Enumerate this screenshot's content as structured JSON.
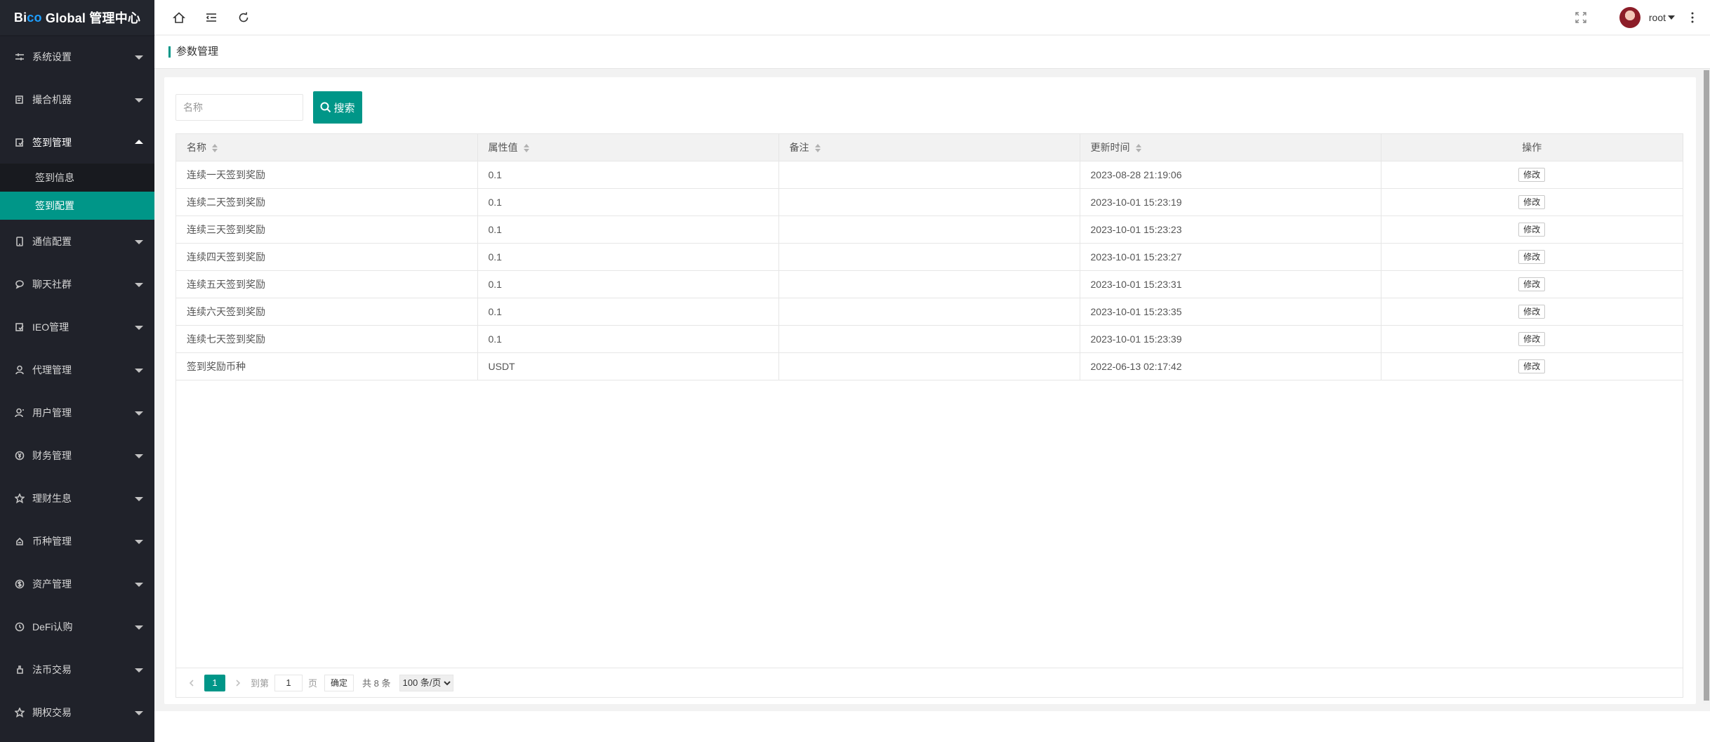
{
  "logo": {
    "part1": "Bi",
    "part2": "co",
    "part3": " Global 管理中心"
  },
  "sidebar": {
    "items": [
      {
        "label": "系统设置",
        "icon": "sliders-icon"
      },
      {
        "label": "撮合机器",
        "icon": "robot-icon"
      },
      {
        "label": "签到管理",
        "icon": "checkin-icon",
        "open": true
      },
      {
        "label": "通信配置",
        "icon": "phone-icon"
      },
      {
        "label": "聊天社群",
        "icon": "chat-icon"
      },
      {
        "label": "IEO管理",
        "icon": "ieo-icon"
      },
      {
        "label": "代理管理",
        "icon": "agent-icon"
      },
      {
        "label": "用户管理",
        "icon": "user-icon"
      },
      {
        "label": "财务管理",
        "icon": "yen-icon"
      },
      {
        "label": "理财生息",
        "icon": "star-icon"
      },
      {
        "label": "币种管理",
        "icon": "coin-icon"
      },
      {
        "label": "资产管理",
        "icon": "dollar-icon"
      },
      {
        "label": "DeFi认购",
        "icon": "clock-icon"
      },
      {
        "label": "法币交易",
        "icon": "hand-icon"
      },
      {
        "label": "期权交易",
        "icon": "star-icon"
      }
    ],
    "sub": [
      "签到信息",
      "签到配置"
    ]
  },
  "header": {
    "username": "root"
  },
  "tab": {
    "title": "参数管理"
  },
  "search": {
    "placeholder": "名称",
    "button": "搜索"
  },
  "table": {
    "headers": [
      "名称",
      "属性值",
      "备注",
      "更新时间",
      "操作"
    ],
    "rows": [
      {
        "name": "连续一天签到奖励",
        "value": "0.1",
        "remark": "",
        "time": "2023-08-28 21:19:06",
        "action": "修改"
      },
      {
        "name": "连续二天签到奖励",
        "value": "0.1",
        "remark": "",
        "time": "2023-10-01 15:23:19",
        "action": "修改"
      },
      {
        "name": "连续三天签到奖励",
        "value": "0.1",
        "remark": "",
        "time": "2023-10-01 15:23:23",
        "action": "修改"
      },
      {
        "name": "连续四天签到奖励",
        "value": "0.1",
        "remark": "",
        "time": "2023-10-01 15:23:27",
        "action": "修改"
      },
      {
        "name": "连续五天签到奖励",
        "value": "0.1",
        "remark": "",
        "time": "2023-10-01 15:23:31",
        "action": "修改"
      },
      {
        "name": "连续六天签到奖励",
        "value": "0.1",
        "remark": "",
        "time": "2023-10-01 15:23:35",
        "action": "修改"
      },
      {
        "name": "连续七天签到奖励",
        "value": "0.1",
        "remark": "",
        "time": "2023-10-01 15:23:39",
        "action": "修改"
      },
      {
        "name": "签到奖励币种",
        "value": "USDT",
        "remark": "",
        "time": "2022-06-13 02:17:42",
        "action": "修改"
      }
    ]
  },
  "pager": {
    "current": "1",
    "goto_label": "到第",
    "goto_value": "1",
    "page_unit": "页",
    "ok": "确定",
    "count": "共 8 条",
    "limit": "100 条/页"
  },
  "colors": {
    "accent": "#009688",
    "sidebar_bg": "#20222a"
  }
}
